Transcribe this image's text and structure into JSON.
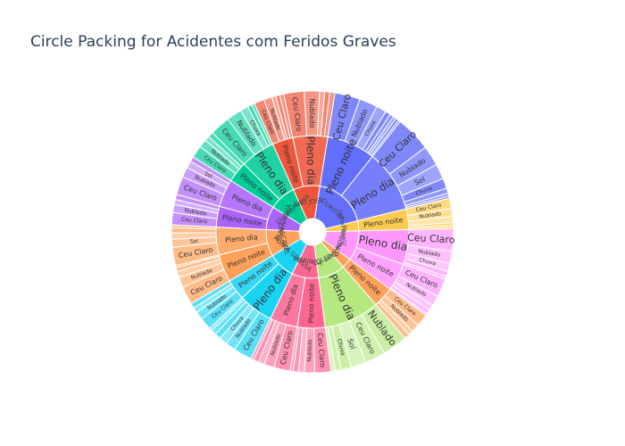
{
  "chart_data": {
    "type": "sunburst",
    "title": "Circle Packing for Acidentes com Feridos Graves",
    "cities": [
      {
        "name": "CURITIBA",
        "value": 16,
        "color": "#636efa",
        "children": [
          {
            "name": "Pleno noite",
            "value": 7,
            "children": [
              {
                "name": "Ceu Claro",
                "value": 2.5
              },
              {
                "name": "Nublado",
                "value": 1.8
              },
              {
                "name": "Chuva",
                "value": 1.0
              },
              {
                "name": "Sol",
                "value": 0.5
              },
              {
                "name": "Ceu Claro",
                "value": 0.4
              },
              {
                "name": "Nublado",
                "value": 0.3
              },
              {
                "name": "",
                "value": 0.3
              },
              {
                "name": "",
                "value": 0.2
              }
            ]
          },
          {
            "name": "Pleno dia",
            "value": 9,
            "children": [
              {
                "name": "Ceu Claro",
                "value": 3.5
              },
              {
                "name": "Nublado",
                "value": 2.0
              },
              {
                "name": "Sol",
                "value": 1.5
              },
              {
                "name": "Chuva",
                "value": 1.0
              },
              {
                "name": "",
                "value": 0.5
              },
              {
                "name": "",
                "value": 0.3
              },
              {
                "name": "",
                "value": 0.2
              }
            ]
          }
        ]
      },
      {
        "name": "FOZ DO IGUACU",
        "value": 3,
        "color": "#fecb52",
        "children": [
          {
            "name": "Pleno noite",
            "value": 3,
            "children": [
              {
                "name": "Ceu Claro",
                "value": 1.0
              },
              {
                "name": "Nublado",
                "value": 0.8
              },
              {
                "name": "Sol",
                "value": 0.6
              },
              {
                "name": "Chuva",
                "value": 0.3
              },
              {
                "name": "",
                "value": 0.3
              }
            ]
          }
        ]
      },
      {
        "name": "LONDRINA",
        "value": 9,
        "color": "#ff97ff",
        "children": [
          {
            "name": "Pleno dia",
            "value": 5,
            "children": [
              {
                "name": "Ceu Claro",
                "value": 2.2
              },
              {
                "name": "Nublado",
                "value": 1.2
              },
              {
                "name": "Chuva",
                "value": 0.8
              },
              {
                "name": "Sol",
                "value": 0.5
              },
              {
                "name": "",
                "value": 0.3
              }
            ]
          },
          {
            "name": "Pleno noite",
            "value": 4,
            "children": [
              {
                "name": "Ceu Claro",
                "value": 1.8
              },
              {
                "name": "Nublado",
                "value": 1.0
              },
              {
                "name": "Chuva",
                "value": 0.6
              },
              {
                "name": "",
                "value": 0.4
              },
              {
                "name": "",
                "value": 0.2
              }
            ]
          }
        ]
      },
      {
        "name": "ARAUCARIA",
        "value": 3,
        "color": "#ffa15a",
        "children": [
          {
            "name": "Pleno noite",
            "value": 3,
            "children": [
              {
                "name": "Ceu Claro",
                "value": 1.2
              },
              {
                "name": "Nublado",
                "value": 0.8
              },
              {
                "name": "Chuva",
                "value": 0.5
              },
              {
                "name": "",
                "value": 0.5
              }
            ]
          }
        ]
      },
      {
        "name": "TOLEDO",
        "value": 8,
        "color": "#b6e880",
        "children": [
          {
            "name": "Pleno dia",
            "value": 8,
            "children": [
              {
                "name": "Nublado",
                "value": 2.5
              },
              {
                "name": "Ceu Claro",
                "value": 2.0
              },
              {
                "name": "Sol",
                "value": 1.5
              },
              {
                "name": "Chuva",
                "value": 1.0
              },
              {
                "name": "",
                "value": 0.6
              },
              {
                "name": "",
                "value": 0.4
              }
            ]
          }
        ]
      },
      {
        "name": "MARINGA",
        "value": 8,
        "color": "#ff6692",
        "children": [
          {
            "name": "Pleno noite",
            "value": 4,
            "children": [
              {
                "name": "Ceu Claro",
                "value": 1.6
              },
              {
                "name": "Nublado",
                "value": 1.0
              },
              {
                "name": "Chuva",
                "value": 0.6
              },
              {
                "name": "",
                "value": 0.5
              },
              {
                "name": "",
                "value": 0.3
              }
            ]
          },
          {
            "name": "Pleno dia",
            "value": 4,
            "children": [
              {
                "name": "Ceu Claro",
                "value": 1.6
              },
              {
                "name": "Nublado",
                "value": 1.0
              },
              {
                "name": "Sol",
                "value": 0.6
              },
              {
                "name": "",
                "value": 0.5
              },
              {
                "name": "",
                "value": 0.3
              }
            ]
          }
        ]
      },
      {
        "name": "PONTA GROSSA",
        "value": 8,
        "color": "#19d3f3",
        "children": [
          {
            "name": "Pleno dia",
            "value": 5,
            "children": [
              {
                "name": "Ceu Claro",
                "value": 1.8
              },
              {
                "name": "Nublado",
                "value": 1.0
              },
              {
                "name": "Chuva",
                "value": 0.8
              },
              {
                "name": "Sol",
                "value": 0.6
              },
              {
                "name": "",
                "value": 0.5
              },
              {
                "name": "",
                "value": 0.3
              }
            ]
          },
          {
            "name": "Pleno noite",
            "value": 3,
            "children": [
              {
                "name": "Ceu Claro",
                "value": 1.2
              },
              {
                "name": "Nublado",
                "value": 0.8
              },
              {
                "name": "",
                "value": 0.5
              },
              {
                "name": "",
                "value": 0.5
              }
            ]
          }
        ]
      },
      {
        "name": "CASCAVEL",
        "value": 8,
        "color": "#ffa15a",
        "children": [
          {
            "name": "Pleno noite",
            "value": 4,
            "children": [
              {
                "name": "Ceu Claro",
                "value": 1.8
              },
              {
                "name": "Nublado",
                "value": 1.0
              },
              {
                "name": "Sol",
                "value": 0.6
              },
              {
                "name": "",
                "value": 0.4
              },
              {
                "name": "",
                "value": 0.2
              }
            ]
          },
          {
            "name": "Pleno dia",
            "value": 4,
            "children": [
              {
                "name": "Ceu Claro",
                "value": 1.8
              },
              {
                "name": "Sol",
                "value": 0.8
              },
              {
                "name": "Nublado",
                "value": 0.6
              },
              {
                "name": "",
                "value": 0.5
              },
              {
                "name": "",
                "value": 0.3
              }
            ]
          }
        ]
      },
      {
        "name": "PARANAGUA",
        "value": 7,
        "color": "#ab63fa",
        "children": [
          {
            "name": "Pleno noite",
            "value": 3,
            "children": [
              {
                "name": "Ceu Claro",
                "value": 1.2
              },
              {
                "name": "Nublado",
                "value": 0.8
              },
              {
                "name": "",
                "value": 0.5
              },
              {
                "name": "",
                "value": 0.5
              }
            ]
          },
          {
            "name": "Pleno dia",
            "value": 4,
            "children": [
              {
                "name": "Ceu Claro",
                "value": 1.8
              },
              {
                "name": "Nublado",
                "value": 1.0
              },
              {
                "name": "Sol",
                "value": 0.7
              },
              {
                "name": "",
                "value": 0.5
              }
            ]
          }
        ]
      },
      {
        "name": "GUARAPUAVA",
        "value": 8,
        "color": "#00cc96",
        "children": [
          {
            "name": "Pleno noite",
            "value": 3,
            "children": [
              {
                "name": "Ceu Claro",
                "value": 1.2
              },
              {
                "name": "Nublado",
                "value": 0.8
              },
              {
                "name": "",
                "value": 0.5
              },
              {
                "name": "",
                "value": 0.5
              }
            ]
          },
          {
            "name": "Pleno dia",
            "value": 5,
            "children": [
              {
                "name": "Ceu Claro",
                "value": 2.0
              },
              {
                "name": "Nublado",
                "value": 1.5
              },
              {
                "name": "Chuva",
                "value": 0.8
              },
              {
                "name": "",
                "value": 0.4
              },
              {
                "name": "",
                "value": 0.3
              }
            ]
          }
        ]
      },
      {
        "name": "SAO JOSE",
        "value": 8,
        "color": "#ef553b",
        "children": [
          {
            "name": "Pleno noite",
            "value": 3,
            "children": [
              {
                "name": "Ceu Claro",
                "value": 1.0
              },
              {
                "name": "Nublado",
                "value": 0.8
              },
              {
                "name": "Sol",
                "value": 0.4
              },
              {
                "name": "",
                "value": 0.4
              },
              {
                "name": "",
                "value": 0.4
              }
            ]
          },
          {
            "name": "Pleno dia",
            "value": 5,
            "children": [
              {
                "name": "Ceu Claro",
                "value": 2.0
              },
              {
                "name": "Nublado",
                "value": 1.5
              },
              {
                "name": "",
                "value": 0.5
              },
              {
                "name": "",
                "value": 0.5
              },
              {
                "name": "",
                "value": 0.5
              }
            ]
          }
        ]
      }
    ]
  }
}
